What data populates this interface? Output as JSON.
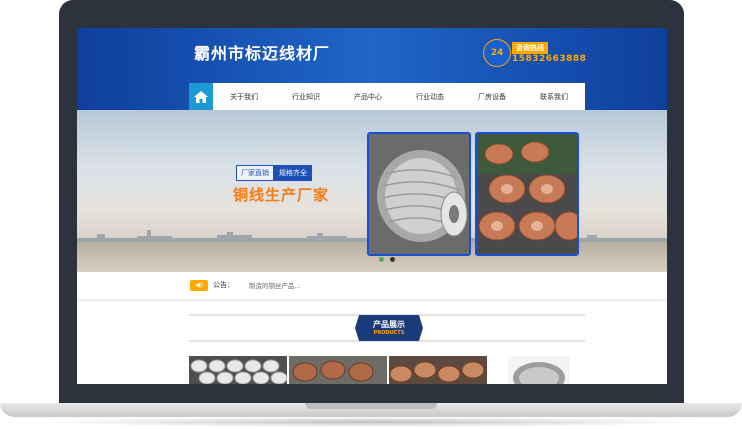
{
  "site": {
    "title": "霸州市标迈线材厂",
    "hotline_badge": "24",
    "hotline_label": "咨询热线",
    "hotline_number": "15832663888"
  },
  "nav": {
    "home_icon": "home-icon",
    "items": [
      "关于我们",
      "行业知识",
      "产品中心",
      "行业动态",
      "厂房设备",
      "联系我们"
    ]
  },
  "banner": {
    "tag1": "厂家直销",
    "tag2": "规格齐全",
    "slogan": "铜线生产厂家",
    "slide_count": 2,
    "active_slide": 1
  },
  "notice": {
    "icon": "speaker-icon",
    "label": "公告：",
    "text": "制造的铜丝产品..."
  },
  "products": {
    "section_title": "产品展示",
    "section_subtitle": "PRODUCTS"
  },
  "colors": {
    "header_blue": "#1f66c8",
    "nav_home": "#1c9ad6",
    "accent_orange": "#f57b16",
    "hotline_orange": "#ffa800",
    "tag_blue": "#1e4fb7"
  }
}
